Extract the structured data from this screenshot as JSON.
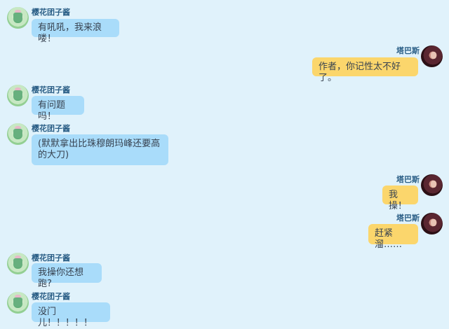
{
  "messages": [
    {
      "side": "left",
      "name": "樱花团子酱",
      "text": "有吼吼，我来浪喽！"
    },
    {
      "side": "right",
      "name": "塔巴斯",
      "text": "作者，你记性太不好了。"
    },
    {
      "side": "left",
      "name": "樱花团子酱",
      "text": "有问题吗！"
    },
    {
      "side": "left",
      "name": "樱花团子酱",
      "text": "(默默拿出比珠穆朗玛峰还要高的大刀)"
    },
    {
      "side": "right",
      "name": "塔巴斯",
      "text": "我操！"
    },
    {
      "side": "right",
      "name": "塔巴斯",
      "text": "赶紧溜……"
    },
    {
      "side": "left",
      "name": "樱花团子酱",
      "text": "我操你还想跑?"
    },
    {
      "side": "left",
      "name": "樱花团子酱",
      "text": "没门儿！！！！！"
    }
  ],
  "colors": {
    "background": "#e0f2fb",
    "left_bubble": "#a9dcfa",
    "right_bubble": "#fbd66c",
    "name_text": "#2a5e86"
  }
}
